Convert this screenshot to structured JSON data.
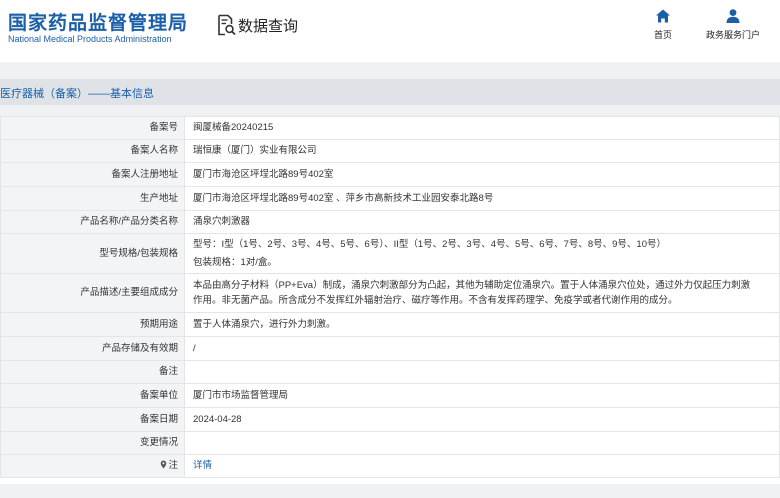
{
  "header": {
    "logo_cn": "国家药品监督管理局",
    "logo_en": "National Medical Products Administration",
    "query_title": "数据查询",
    "nav": [
      {
        "label": "首页",
        "icon": "home-icon"
      },
      {
        "label": "政务服务门户",
        "icon": "user-icon"
      }
    ]
  },
  "section": {
    "title": "医疗器械（备案）——基本信息"
  },
  "rows": [
    {
      "label": "备案号",
      "value": "闽厦械备20240215"
    },
    {
      "label": "备案人名称",
      "value": "瑞恒康（厦门）实业有限公司"
    },
    {
      "label": "备案人注册地址",
      "value": "厦门市海沧区坪埕北路89号402室"
    },
    {
      "label": "生产地址",
      "value": "厦门市海沧区坪埕北路89号402室 、萍乡市高新技术工业园安泰北路8号"
    },
    {
      "label": "产品名称/产品分类名称",
      "value": "涌泉穴刺激器"
    },
    {
      "label": "型号规格/包装规格",
      "value": "型号：I型（1号、2号、3号、4号、5号、6号）、II型（1号、2号、3号、4号、5号、6号、7号、8号、9号、10号）",
      "value2": "包装规格：1对/盒。"
    },
    {
      "label": "产品描述/主要组成成分",
      "value": "本品由高分子材料（PP+Eva）制成，涌泉穴刺激部分为凸起，其他为辅助定位涌泉穴。置于人体涌泉穴位处，通过外力仅起压力刺激",
      "value2": "作用。非无菌产品。所含成分不发挥红外辐射治疗、磁疗等作用。不含有发挥药理学、免疫学或者代谢作用的成分。"
    },
    {
      "label": "预期用途",
      "value": "置于人体涌泉穴，进行外力刺激。"
    },
    {
      "label": "产品存储及有效期",
      "value": "/"
    },
    {
      "label": "备注",
      "value": ""
    },
    {
      "label": "备案单位",
      "value": "厦门市市场监督管理局"
    },
    {
      "label": "备案日期",
      "value": "2024-04-28"
    },
    {
      "label": "变更情况",
      "value": ""
    },
    {
      "label": "注",
      "value": "详情",
      "icon": "location-pin-icon"
    }
  ],
  "colors": {
    "brand": "#1b5fa8",
    "label_bg": "#f3f4f6",
    "section_bg": "#dfe3e8",
    "border": "#e2e5e9"
  }
}
